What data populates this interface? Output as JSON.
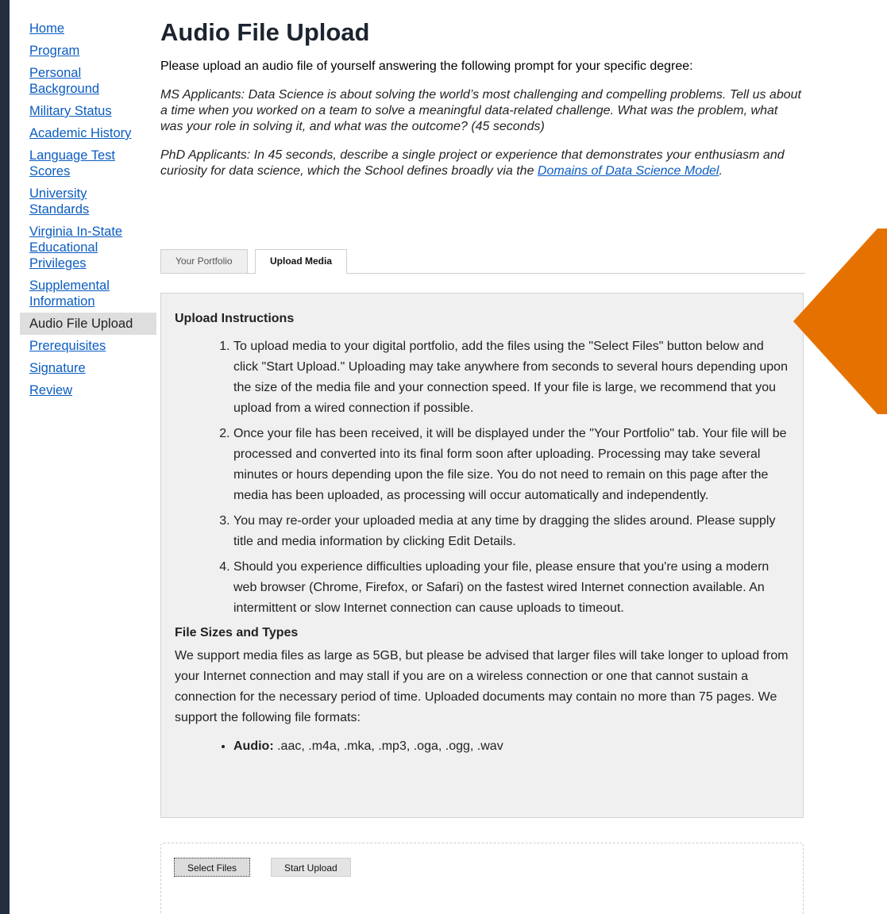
{
  "sidebar": {
    "items": [
      {
        "label": "Home"
      },
      {
        "label": "Program"
      },
      {
        "label": "Personal Background"
      },
      {
        "label": "Military Status"
      },
      {
        "label": "Academic History"
      },
      {
        "label": "Language Test Scores"
      },
      {
        "label": "University Standards"
      },
      {
        "label": "Virginia In-State Educational Privileges"
      },
      {
        "label": "Supplemental Information"
      },
      {
        "label": "Audio File Upload",
        "active": true
      },
      {
        "label": "Prerequisites"
      },
      {
        "label": "Signature"
      },
      {
        "label": "Review"
      }
    ]
  },
  "main": {
    "title": "Audio File Upload",
    "intro": "Please upload an audio file of yourself answering the following prompt for your specific degree:",
    "ms_prompt": "MS Applicants: Data Science is about solving the world’s most challenging and compelling problems. Tell us about a time when you worked on a team to solve a meaningful data-related challenge. What was the problem, what was your role in solving it, and what was the outcome? (45 seconds)",
    "phd_prompt_before": "PhD Applicants: In 45 seconds, describe a single project or experience that demonstrates your enthusiasm and curiosity for data science, which the School defines broadly via the ",
    "phd_prompt_link": "Domains of Data Science Model",
    "phd_prompt_after": "."
  },
  "tabs": [
    {
      "label": "Your Portfolio"
    },
    {
      "label": "Upload Media"
    }
  ],
  "instructions": {
    "heading": "Upload Instructions",
    "steps": [
      "To upload media to your digital portfolio, add the files using the \"Select Files\" button below and click \"Start Upload.\" Uploading may take anywhere from seconds to several hours depending upon the size of the media file and your connection speed. If your file is large, we recommend that you upload from a wired connection if possible.",
      "Once your file has been received, it will be displayed under the \"Your Portfolio\" tab. Your file will be processed and converted into its final form soon after uploading. Processing may take several minutes or hours depending upon the file size. You do not need to remain on this page after the media has been uploaded, as processing will occur automatically and independently.",
      "You may re-order your uploaded media at any time by dragging the slides around. Please supply title and media information by clicking Edit Details.",
      "Should you experience difficulties uploading your file, please ensure that you're using a modern web browser (Chrome, Firefox, or Safari) on the fastest wired Internet connection available. An intermittent or slow Internet connection can cause uploads to timeout."
    ],
    "sizes_heading": "File Sizes and Types",
    "sizes_text": "We support media files as large as 5GB, but please be advised that larger files will take longer to upload from your Internet connection and may stall if you are on a wireless connection or one that cannot sustain a connection for the necessary period of time. Uploaded documents may contain no more than 75 pages. We support the following file formats:",
    "formats": [
      {
        "label": "Audio:",
        "value": ".aac, .m4a, .mka, .mp3, .oga, .ogg, .wav"
      }
    ]
  },
  "upload": {
    "select_label": "Select Files",
    "start_label": "Start Upload"
  },
  "colors": {
    "link": "#0b5cc1",
    "frame": "#232f3e",
    "accent": "#e57200"
  }
}
